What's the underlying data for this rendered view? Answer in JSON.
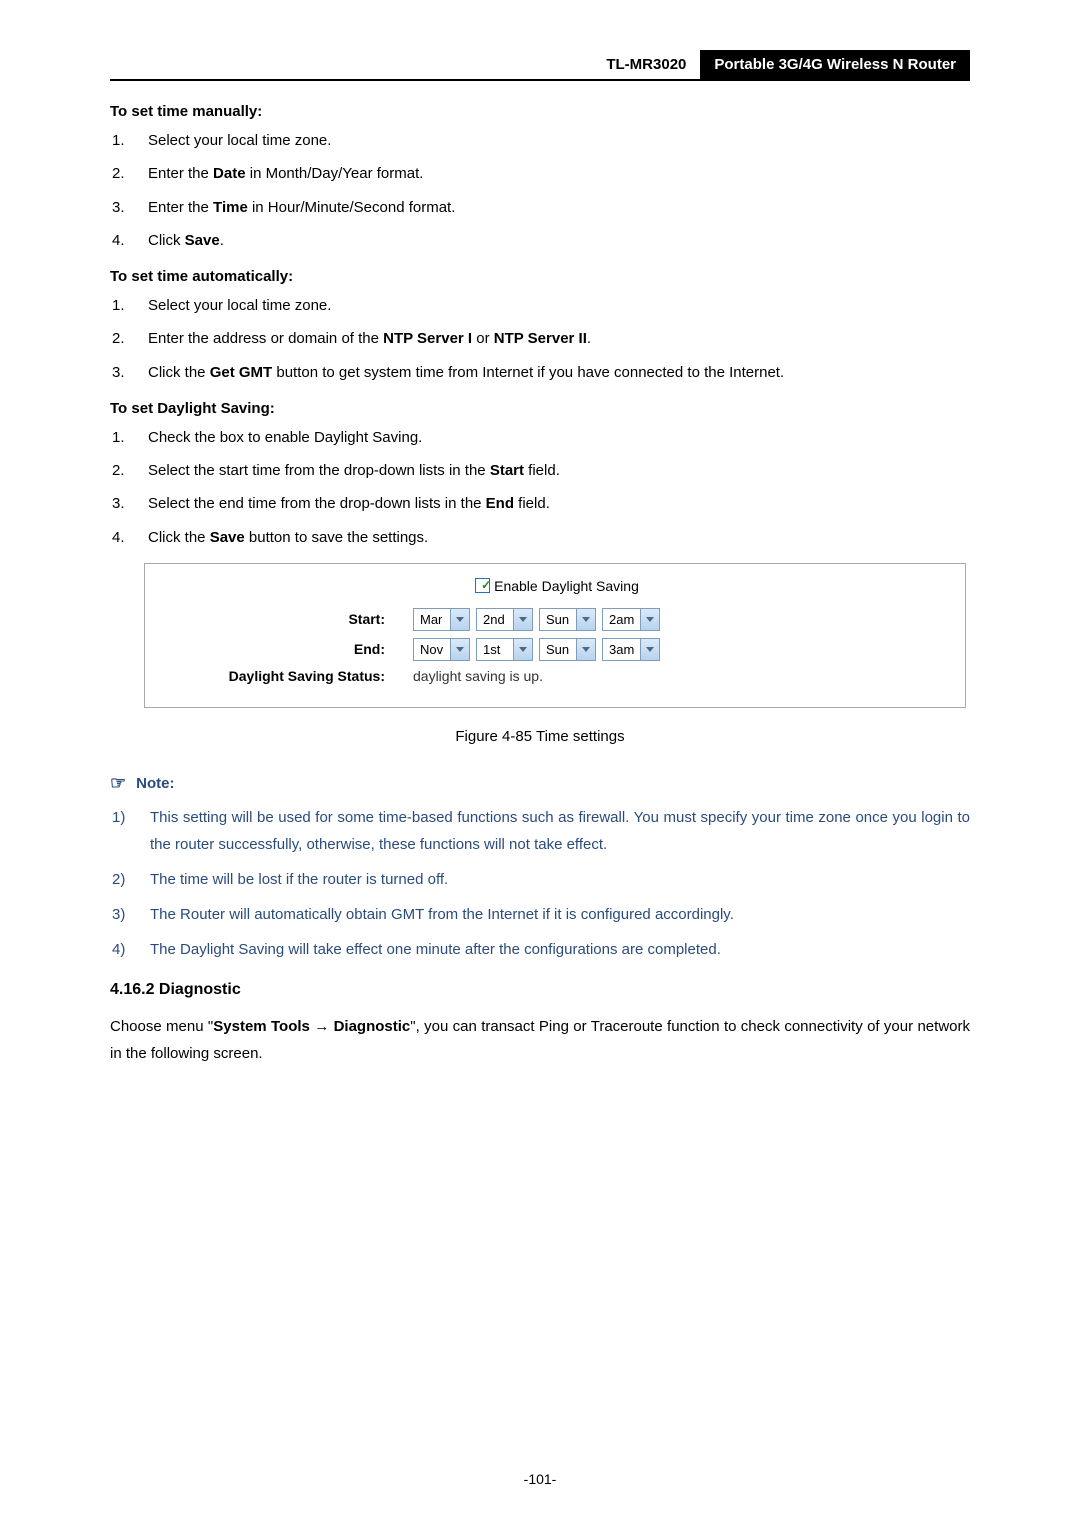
{
  "header": {
    "model": "TL-MR3020",
    "title": "Portable 3G/4G Wireless N Router"
  },
  "sec1": {
    "title": "To set time manually:",
    "items": [
      {
        "n": "1.",
        "pre": "Select your local time zone.",
        "bold": "",
        "post": ""
      },
      {
        "n": "2.",
        "pre": "Enter the ",
        "bold": "Date",
        "post": " in Month/Day/Year format."
      },
      {
        "n": "3.",
        "pre": "Enter the ",
        "bold": "Time",
        "post": " in Hour/Minute/Second format."
      },
      {
        "n": "4.",
        "pre": "Click ",
        "bold": "Save",
        "post": "."
      }
    ]
  },
  "sec2": {
    "title": "To set time automatically:",
    "l1": {
      "n": "1.",
      "t": "Select your local time zone."
    },
    "l2": {
      "n": "2.",
      "pre": "Enter the address or domain of the ",
      "b1": "NTP Server I",
      "mid": " or ",
      "b2": "NTP Server II",
      "post": "."
    },
    "l3": {
      "n": "3.",
      "pre": "Click the ",
      "b": "Get GMT",
      "post": " button to get system time from Internet if you have connected to the Internet."
    }
  },
  "sec3": {
    "title": "To set Daylight Saving:",
    "l1": {
      "n": "1.",
      "t": "Check the box to enable Daylight Saving."
    },
    "l2": {
      "n": "2.",
      "pre": "Select the start time from the drop-down lists in the ",
      "b": "Start",
      "post": " field."
    },
    "l3": {
      "n": "3.",
      "pre": "Select the end time from the drop-down lists in the ",
      "b": "End",
      "post": " field."
    },
    "l4": {
      "n": "4.",
      "pre": "Click the ",
      "b": "Save",
      "post": " button to save the settings."
    }
  },
  "panel": {
    "enable_label": "Enable Daylight Saving",
    "start_label": "Start:",
    "end_label": "End:",
    "status_label": "Daylight Saving Status:",
    "status_value": "daylight saving is up.",
    "start": {
      "month": "Mar",
      "week": "2nd",
      "day": "Sun",
      "hour": "2am"
    },
    "end": {
      "month": "Nov",
      "week": "1st",
      "day": "Sun",
      "hour": "3am"
    }
  },
  "figure_caption": "Figure 4-85    Time settings",
  "note": {
    "head": "Note:",
    "items": {
      "n1n": "1)",
      "n1": "This setting will be used for some time-based functions such as firewall. You must specify your time zone once you login to the router successfully, otherwise, these functions will not take effect.",
      "n2n": "2)",
      "n2": "The time will be lost if the router is turned off.",
      "n3n": "3)",
      "n3": "The Router will automatically obtain GMT from the Internet if it is configured accordingly.",
      "n4n": "4)",
      "n4": "The Daylight Saving will take effect one minute after the configurations are completed."
    }
  },
  "h3": "4.16.2  Diagnostic",
  "para": {
    "pre": "Choose menu \"",
    "b1": "System Tools",
    "arrow": "  →  ",
    "b2": "Diagnostic",
    "post": "\", you can transact Ping or Traceroute function to check connectivity of your network in the following screen."
  },
  "page_num": "-101-"
}
